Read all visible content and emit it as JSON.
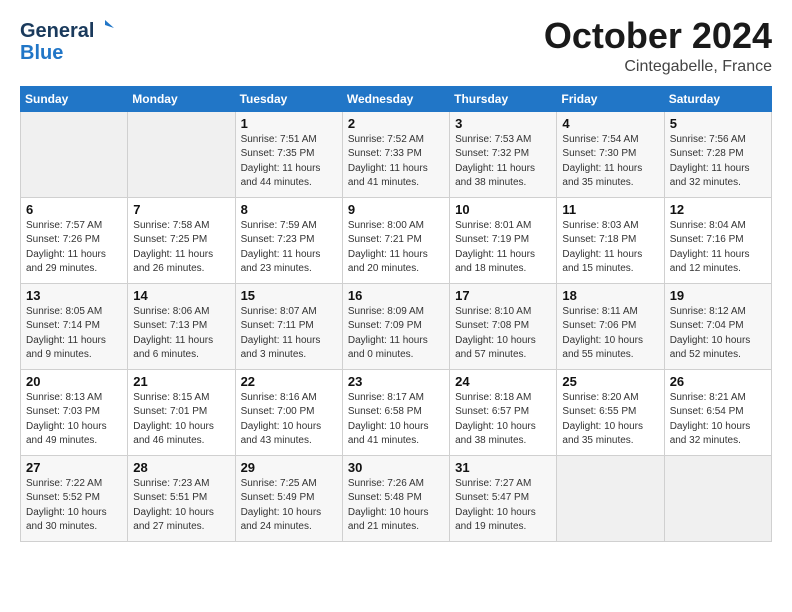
{
  "header": {
    "logo_general": "General",
    "logo_blue": "Blue",
    "month_year": "October 2024",
    "location": "Cintegabelle, France"
  },
  "days_of_week": [
    "Sunday",
    "Monday",
    "Tuesday",
    "Wednesday",
    "Thursday",
    "Friday",
    "Saturday"
  ],
  "weeks": [
    [
      {
        "num": "",
        "detail": ""
      },
      {
        "num": "",
        "detail": ""
      },
      {
        "num": "1",
        "detail": "Sunrise: 7:51 AM\nSunset: 7:35 PM\nDaylight: 11 hours\nand 44 minutes."
      },
      {
        "num": "2",
        "detail": "Sunrise: 7:52 AM\nSunset: 7:33 PM\nDaylight: 11 hours\nand 41 minutes."
      },
      {
        "num": "3",
        "detail": "Sunrise: 7:53 AM\nSunset: 7:32 PM\nDaylight: 11 hours\nand 38 minutes."
      },
      {
        "num": "4",
        "detail": "Sunrise: 7:54 AM\nSunset: 7:30 PM\nDaylight: 11 hours\nand 35 minutes."
      },
      {
        "num": "5",
        "detail": "Sunrise: 7:56 AM\nSunset: 7:28 PM\nDaylight: 11 hours\nand 32 minutes."
      }
    ],
    [
      {
        "num": "6",
        "detail": "Sunrise: 7:57 AM\nSunset: 7:26 PM\nDaylight: 11 hours\nand 29 minutes."
      },
      {
        "num": "7",
        "detail": "Sunrise: 7:58 AM\nSunset: 7:25 PM\nDaylight: 11 hours\nand 26 minutes."
      },
      {
        "num": "8",
        "detail": "Sunrise: 7:59 AM\nSunset: 7:23 PM\nDaylight: 11 hours\nand 23 minutes."
      },
      {
        "num": "9",
        "detail": "Sunrise: 8:00 AM\nSunset: 7:21 PM\nDaylight: 11 hours\nand 20 minutes."
      },
      {
        "num": "10",
        "detail": "Sunrise: 8:01 AM\nSunset: 7:19 PM\nDaylight: 11 hours\nand 18 minutes."
      },
      {
        "num": "11",
        "detail": "Sunrise: 8:03 AM\nSunset: 7:18 PM\nDaylight: 11 hours\nand 15 minutes."
      },
      {
        "num": "12",
        "detail": "Sunrise: 8:04 AM\nSunset: 7:16 PM\nDaylight: 11 hours\nand 12 minutes."
      }
    ],
    [
      {
        "num": "13",
        "detail": "Sunrise: 8:05 AM\nSunset: 7:14 PM\nDaylight: 11 hours\nand 9 minutes."
      },
      {
        "num": "14",
        "detail": "Sunrise: 8:06 AM\nSunset: 7:13 PM\nDaylight: 11 hours\nand 6 minutes."
      },
      {
        "num": "15",
        "detail": "Sunrise: 8:07 AM\nSunset: 7:11 PM\nDaylight: 11 hours\nand 3 minutes."
      },
      {
        "num": "16",
        "detail": "Sunrise: 8:09 AM\nSunset: 7:09 PM\nDaylight: 11 hours\nand 0 minutes."
      },
      {
        "num": "17",
        "detail": "Sunrise: 8:10 AM\nSunset: 7:08 PM\nDaylight: 10 hours\nand 57 minutes."
      },
      {
        "num": "18",
        "detail": "Sunrise: 8:11 AM\nSunset: 7:06 PM\nDaylight: 10 hours\nand 55 minutes."
      },
      {
        "num": "19",
        "detail": "Sunrise: 8:12 AM\nSunset: 7:04 PM\nDaylight: 10 hours\nand 52 minutes."
      }
    ],
    [
      {
        "num": "20",
        "detail": "Sunrise: 8:13 AM\nSunset: 7:03 PM\nDaylight: 10 hours\nand 49 minutes."
      },
      {
        "num": "21",
        "detail": "Sunrise: 8:15 AM\nSunset: 7:01 PM\nDaylight: 10 hours\nand 46 minutes."
      },
      {
        "num": "22",
        "detail": "Sunrise: 8:16 AM\nSunset: 7:00 PM\nDaylight: 10 hours\nand 43 minutes."
      },
      {
        "num": "23",
        "detail": "Sunrise: 8:17 AM\nSunset: 6:58 PM\nDaylight: 10 hours\nand 41 minutes."
      },
      {
        "num": "24",
        "detail": "Sunrise: 8:18 AM\nSunset: 6:57 PM\nDaylight: 10 hours\nand 38 minutes."
      },
      {
        "num": "25",
        "detail": "Sunrise: 8:20 AM\nSunset: 6:55 PM\nDaylight: 10 hours\nand 35 minutes."
      },
      {
        "num": "26",
        "detail": "Sunrise: 8:21 AM\nSunset: 6:54 PM\nDaylight: 10 hours\nand 32 minutes."
      }
    ],
    [
      {
        "num": "27",
        "detail": "Sunrise: 7:22 AM\nSunset: 5:52 PM\nDaylight: 10 hours\nand 30 minutes."
      },
      {
        "num": "28",
        "detail": "Sunrise: 7:23 AM\nSunset: 5:51 PM\nDaylight: 10 hours\nand 27 minutes."
      },
      {
        "num": "29",
        "detail": "Sunrise: 7:25 AM\nSunset: 5:49 PM\nDaylight: 10 hours\nand 24 minutes."
      },
      {
        "num": "30",
        "detail": "Sunrise: 7:26 AM\nSunset: 5:48 PM\nDaylight: 10 hours\nand 21 minutes."
      },
      {
        "num": "31",
        "detail": "Sunrise: 7:27 AM\nSunset: 5:47 PM\nDaylight: 10 hours\nand 19 minutes."
      },
      {
        "num": "",
        "detail": ""
      },
      {
        "num": "",
        "detail": ""
      }
    ]
  ]
}
